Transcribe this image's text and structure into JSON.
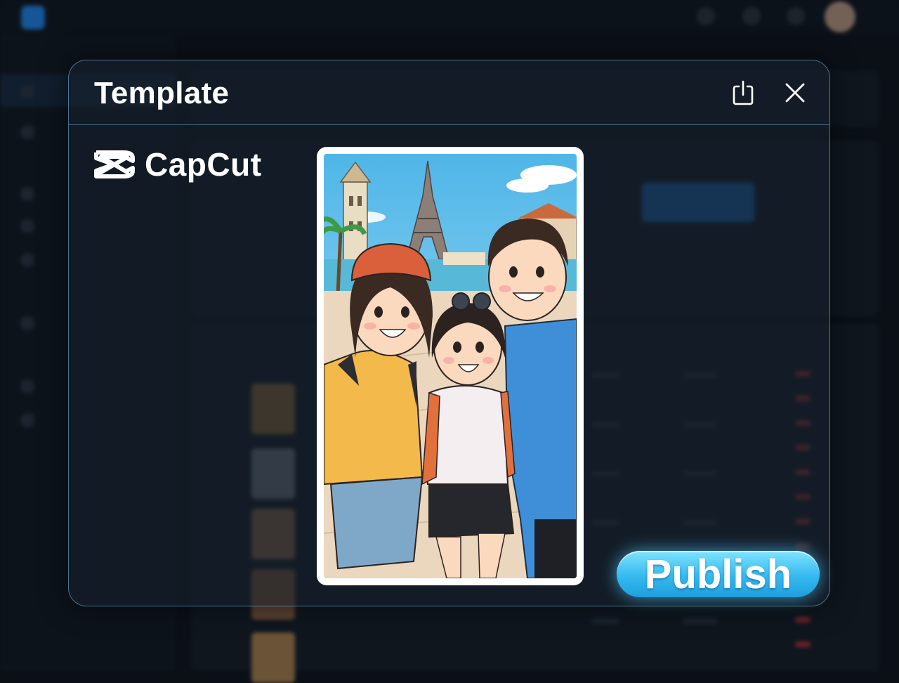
{
  "modal": {
    "title": "Template",
    "brand_name": "CapCut",
    "publish_label": "Publish"
  },
  "icons": {
    "share": "share-icon",
    "close": "close-icon",
    "brand": "capcut-logo-icon"
  },
  "colors": {
    "accent": "#35b9ef",
    "modal_border": "#78b9e6",
    "background": "#0b1017"
  },
  "illustration": {
    "subject": "cartoon-three-friends-selfie-eiffel-tower"
  }
}
